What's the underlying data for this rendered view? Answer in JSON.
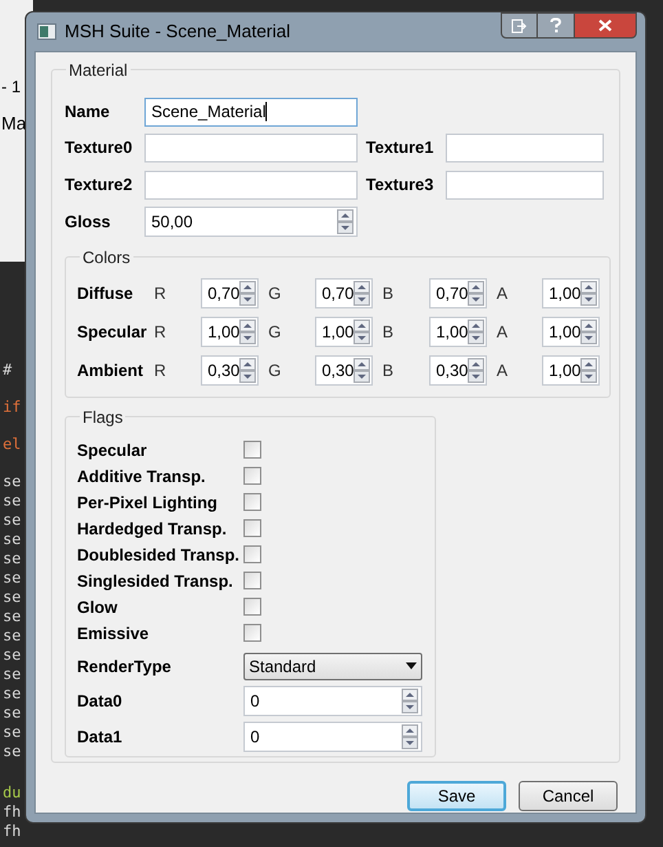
{
  "background": {
    "tab_text": "- 1",
    "tab_label": "Ma",
    "code_lines": [
      {
        "text": "#",
        "kind": "plain"
      },
      {
        "text": "if",
        "kind": "keyword"
      },
      {
        "text": "el",
        "kind": "keyword"
      },
      {
        "text": "se",
        "kind": "plain"
      },
      {
        "text": "se",
        "kind": "plain"
      },
      {
        "text": "se",
        "kind": "plain"
      },
      {
        "text": "se",
        "kind": "plain"
      },
      {
        "text": "se",
        "kind": "plain"
      },
      {
        "text": "se",
        "kind": "plain"
      },
      {
        "text": "se",
        "kind": "plain"
      },
      {
        "text": "se",
        "kind": "plain"
      },
      {
        "text": "se",
        "kind": "plain"
      },
      {
        "text": "se",
        "kind": "plain"
      },
      {
        "text": "se",
        "kind": "plain"
      },
      {
        "text": "se",
        "kind": "plain"
      },
      {
        "text": "se",
        "kind": "plain"
      },
      {
        "text": "se",
        "kind": "plain"
      },
      {
        "text": "se",
        "kind": "plain"
      },
      {
        "text": "du",
        "kind": "call"
      },
      {
        "text": "fh",
        "kind": "plain"
      },
      {
        "text": "fh",
        "kind": "plain"
      }
    ]
  },
  "window": {
    "title": "MSH Suite - Scene_Material"
  },
  "material": {
    "title": "Material",
    "name": {
      "label": "Name",
      "value": "Scene_Material",
      "focused": true
    },
    "textures": [
      {
        "label": "Texture0"
      },
      {
        "label": "Texture1"
      },
      {
        "label": "Texture2"
      },
      {
        "label": "Texture3"
      }
    ],
    "gloss": {
      "label": "Gloss",
      "value": "50,00"
    },
    "colors": {
      "title": "Colors",
      "rows": [
        {
          "label": "Diffuse",
          "channels": [
            {
              "label": "R",
              "value": "0,70"
            },
            {
              "label": "G",
              "value": "0,70"
            },
            {
              "label": "B",
              "value": "0,70"
            },
            {
              "label": "A",
              "value": "1,00"
            }
          ]
        },
        {
          "label": "Specular",
          "channels": [
            {
              "label": "R",
              "value": "1,00"
            },
            {
              "label": "G",
              "value": "1,00"
            },
            {
              "label": "B",
              "value": "1,00"
            },
            {
              "label": "A",
              "value": "1,00"
            }
          ]
        },
        {
          "label": "Ambient",
          "channels": [
            {
              "label": "R",
              "value": "0,30"
            },
            {
              "label": "G",
              "value": "0,30"
            },
            {
              "label": "B",
              "value": "0,30"
            },
            {
              "label": "A",
              "value": "1,00"
            }
          ]
        }
      ]
    },
    "flags": {
      "title": "Flags",
      "checkboxes": [
        {
          "label": "Specular",
          "checked": false
        },
        {
          "label": "Additive Transp.",
          "checked": false
        },
        {
          "label": "Per-Pixel Lighting",
          "checked": false
        },
        {
          "label": "Hardedged Transp.",
          "checked": false
        },
        {
          "label": "Doublesided Transp.",
          "checked": false
        },
        {
          "label": "Singlesided Transp.",
          "checked": false
        },
        {
          "label": "Glow",
          "checked": false
        },
        {
          "label": "Emissive",
          "checked": false
        }
      ],
      "render_type": {
        "label": "RenderType",
        "value": "Standard"
      },
      "data": [
        {
          "label": "Data0",
          "value": "0"
        },
        {
          "label": "Data1",
          "value": "0"
        }
      ]
    }
  },
  "buttons": [
    {
      "label": "Save",
      "default": true
    },
    {
      "label": "Cancel",
      "default": false
    }
  ]
}
